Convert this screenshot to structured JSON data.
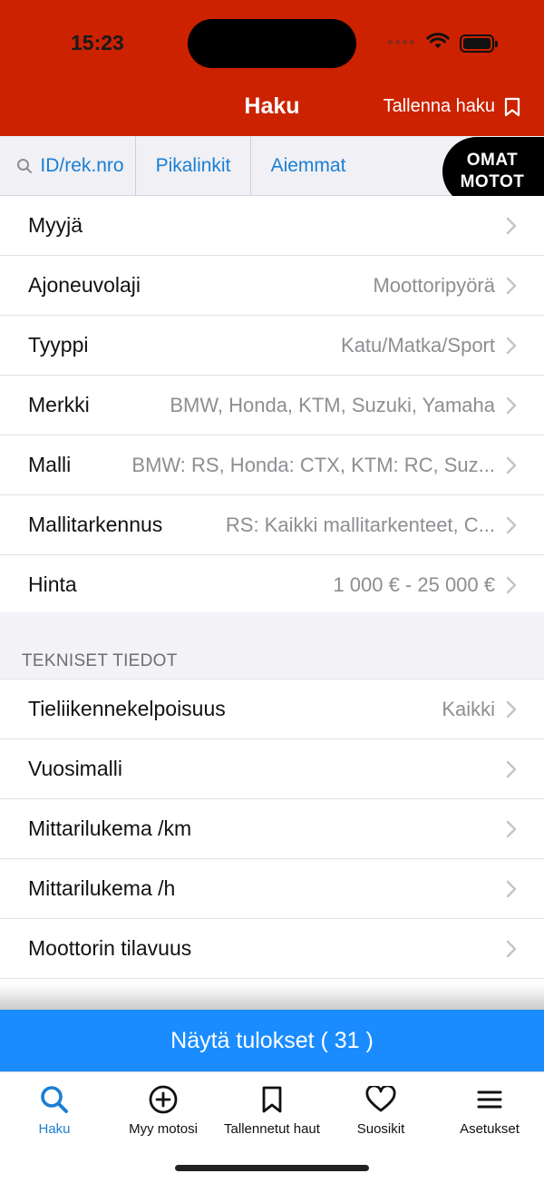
{
  "status_bar": {
    "time": "15:23"
  },
  "header": {
    "title": "Haku",
    "save_label": "Tallenna haku"
  },
  "quickbar": {
    "id_label": "ID/rek.nro",
    "pikalinkit": "Pikalinkit",
    "aiemmat": "Aiemmat",
    "omat_line1": "OMAT",
    "omat_line2": "MOTOT"
  },
  "filters": [
    {
      "label": "Myyjä",
      "value": ""
    },
    {
      "label": "Ajoneuvolaji",
      "value": "Moottoripyörä"
    },
    {
      "label": "Tyyppi",
      "value": "Katu/Matka/Sport"
    },
    {
      "label": "Merkki",
      "value": "BMW, Honda, KTM, Suzuki, Yamaha"
    },
    {
      "label": "Malli",
      "value": "BMW: RS, Honda: CTX, KTM: RC, Suz..."
    },
    {
      "label": "Mallitarkennus",
      "value": "RS: Kaikki mallitarkenteet, C..."
    },
    {
      "label": "Hinta",
      "value": "1 000 € - 25 000 €"
    }
  ],
  "tech_section": {
    "title": "TEKNISET TIEDOT",
    "items": [
      {
        "label": "Tieliikennekelpoisuus",
        "value": "Kaikki"
      },
      {
        "label": "Vuosimalli",
        "value": ""
      },
      {
        "label": "Mittarilukema /km",
        "value": ""
      },
      {
        "label": "Mittarilukema /h",
        "value": ""
      },
      {
        "label": "Moottorin tilavuus",
        "value": ""
      }
    ]
  },
  "results_button": "Näytä tulokset ( 31 )",
  "tabs": [
    {
      "label": "Haku",
      "icon": "search-icon",
      "active": true
    },
    {
      "label": "Myy motosi",
      "icon": "plus-circle-icon",
      "active": false
    },
    {
      "label": "Tallennetut haut",
      "icon": "bookmark-icon",
      "active": false
    },
    {
      "label": "Suosikit",
      "icon": "heart-icon",
      "active": false
    },
    {
      "label": "Asetukset",
      "icon": "menu-icon",
      "active": false
    }
  ],
  "colors": {
    "header": "#cc2200",
    "accent": "#1a8cff",
    "link": "#1a7fd4"
  }
}
